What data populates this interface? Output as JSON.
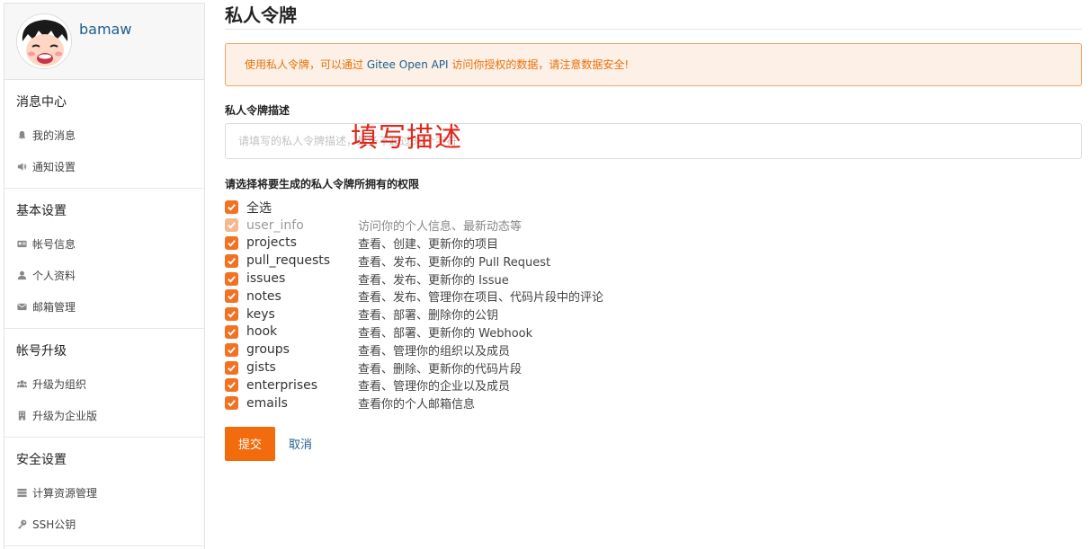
{
  "profile": {
    "username": "bamaw"
  },
  "sidebar": [
    {
      "title": "消息中心",
      "items": [
        {
          "label": "我的消息",
          "icon": "bell-icon"
        },
        {
          "label": "通知设置",
          "icon": "speaker-icon"
        }
      ]
    },
    {
      "title": "基本设置",
      "items": [
        {
          "label": "帐号信息",
          "icon": "id-card-icon"
        },
        {
          "label": "个人资料",
          "icon": "user-icon"
        },
        {
          "label": "邮箱管理",
          "icon": "envelope-icon"
        }
      ]
    },
    {
      "title": "帐号升级",
      "items": [
        {
          "label": "升级为组织",
          "icon": "users-icon"
        },
        {
          "label": "升级为企业版",
          "icon": "building-icon"
        }
      ]
    },
    {
      "title": "安全设置",
      "items": [
        {
          "label": "计算资源管理",
          "icon": "server-icon"
        },
        {
          "label": "SSH公钥",
          "icon": "key-icon"
        }
      ]
    }
  ],
  "main": {
    "title": "私人令牌",
    "alert": {
      "before": "使用私人令牌，可以通过 ",
      "link": "Gitee Open API",
      "after": " 访问你授权的数据，请注意数据安全!"
    },
    "desc_label": "私人令牌描述",
    "desc_placeholder": "请填写的私人令牌描述，最多不超过30个字符",
    "overlay_text": "填写描述",
    "perm_label": "请选择将要生成的私人令牌所拥有的权限",
    "select_all": "全选",
    "permissions": [
      {
        "name": "user_info",
        "desc": "访问你的个人信息、最新动态等",
        "disabled": true
      },
      {
        "name": "projects",
        "desc": "查看、创建、更新你的项目"
      },
      {
        "name": "pull_requests",
        "desc": "查看、发布、更新你的 Pull Request"
      },
      {
        "name": "issues",
        "desc": "查看、发布、更新你的 Issue"
      },
      {
        "name": "notes",
        "desc": "查看、发布、管理你在项目、代码片段中的评论"
      },
      {
        "name": "keys",
        "desc": "查看、部署、删除你的公钥"
      },
      {
        "name": "hook",
        "desc": "查看、部署、更新你的 Webhook"
      },
      {
        "name": "groups",
        "desc": "查看、管理你的组织以及成员"
      },
      {
        "name": "gists",
        "desc": "查看、删除、更新你的代码片段"
      },
      {
        "name": "enterprises",
        "desc": "查看、管理你的企业以及成员"
      },
      {
        "name": "emails",
        "desc": "查看你的个人邮箱信息"
      }
    ],
    "submit": "提交",
    "cancel": "取消"
  },
  "colors": {
    "accent": "#f26b0c",
    "link": "#1f5e8c",
    "alert_bg": "#fdf0e6",
    "overlay": "#e0271b"
  }
}
